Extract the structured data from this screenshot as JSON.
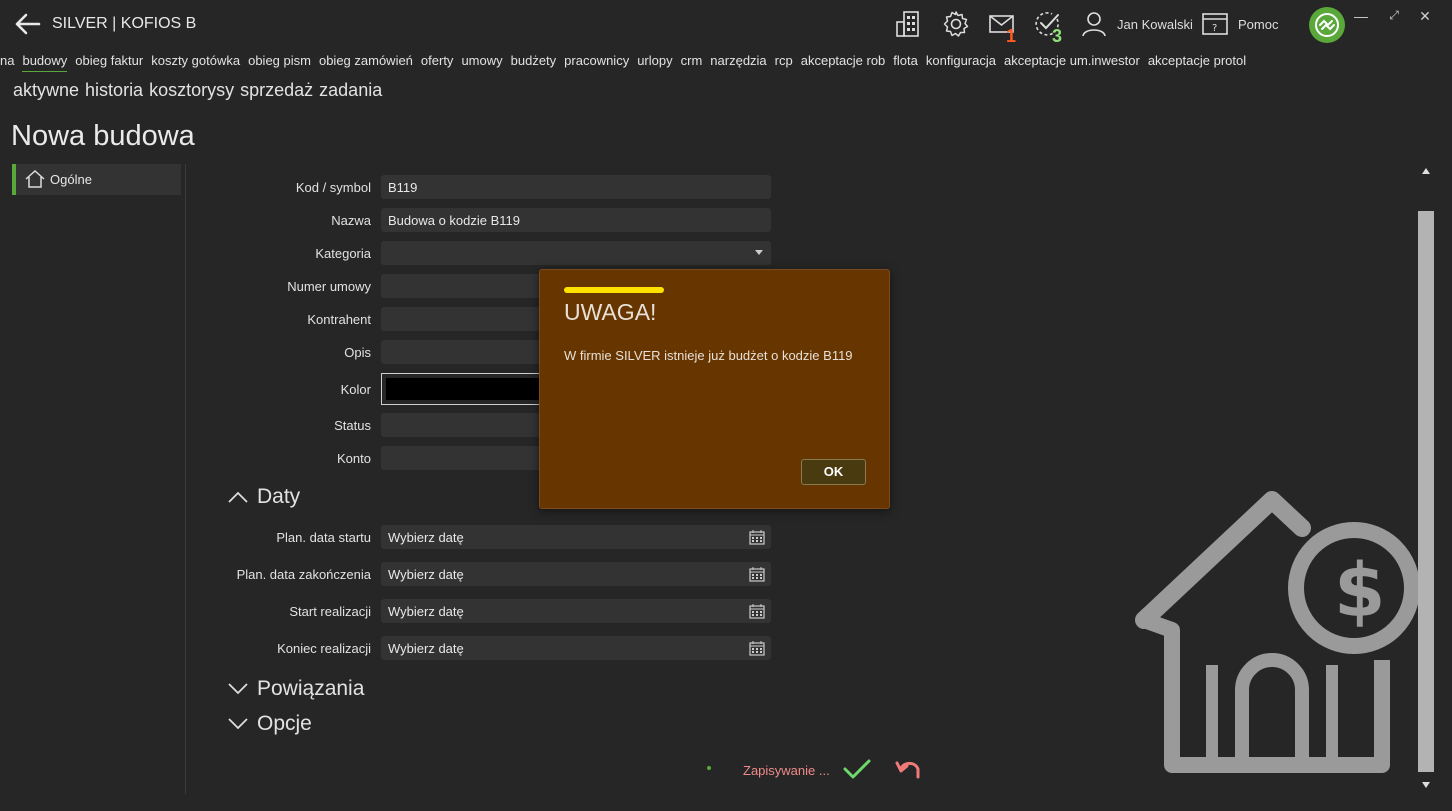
{
  "titlebar": {
    "title": "SILVER | KOFIOS B",
    "mail_count": "1",
    "tasks_count": "3",
    "user_name": "Jan Kowalski",
    "help_label": "Pomoc"
  },
  "menu1": {
    "items": [
      "na",
      "budowy",
      "obieg faktur",
      "koszty gotówka",
      "obieg pism",
      "obieg zamówień",
      "oferty",
      "umowy",
      "budżety",
      "pracownicy",
      "urlopy",
      "crm",
      "narzędzia",
      "rcp",
      "akceptacje rob",
      "flota",
      "konfiguracja",
      "akceptacje um.inwestor",
      "akceptacje protol"
    ],
    "active_index": 1
  },
  "menu2": {
    "items": [
      "aktywne",
      "historia",
      "kosztorysy",
      "sprzedaż",
      "zadania"
    ]
  },
  "page_title": "Nowa budowa",
  "leftnav": {
    "label": "Ogólne"
  },
  "form": {
    "kod_label": "Kod / symbol",
    "kod_value": "B119",
    "nazwa_label": "Nazwa",
    "nazwa_value": "Budowa o kodzie B119",
    "kategoria_label": "Kategoria",
    "numer_label": "Numer umowy",
    "kontrahent_label": "Kontrahent",
    "opis_label": "Opis",
    "kolor_label": "Kolor",
    "status_label": "Status",
    "konto_label": "Konto"
  },
  "daty": {
    "title": "Daty",
    "start_label": "Plan. data startu",
    "end_label": "Plan. data zakończenia",
    "real_start_label": "Start realizacji",
    "real_end_label": "Koniec realizacji",
    "placeholder": "Wybierz datę"
  },
  "sections": {
    "powiazania": "Powiązania",
    "opcje": "Opcje"
  },
  "footer": {
    "saving_text": "Zapisywanie ..."
  },
  "dialog": {
    "title": "UWAGA!",
    "message": "W firmie SILVER istnieje już budżet o kodzie B119",
    "ok_label": "OK"
  },
  "colors": {
    "accent": "#5aa83a",
    "dialog_bg": "#663500",
    "dialog_bar": "#ffe100",
    "mail_badge": "#ff5a1f",
    "tasks_badge": "#8fe07a"
  }
}
